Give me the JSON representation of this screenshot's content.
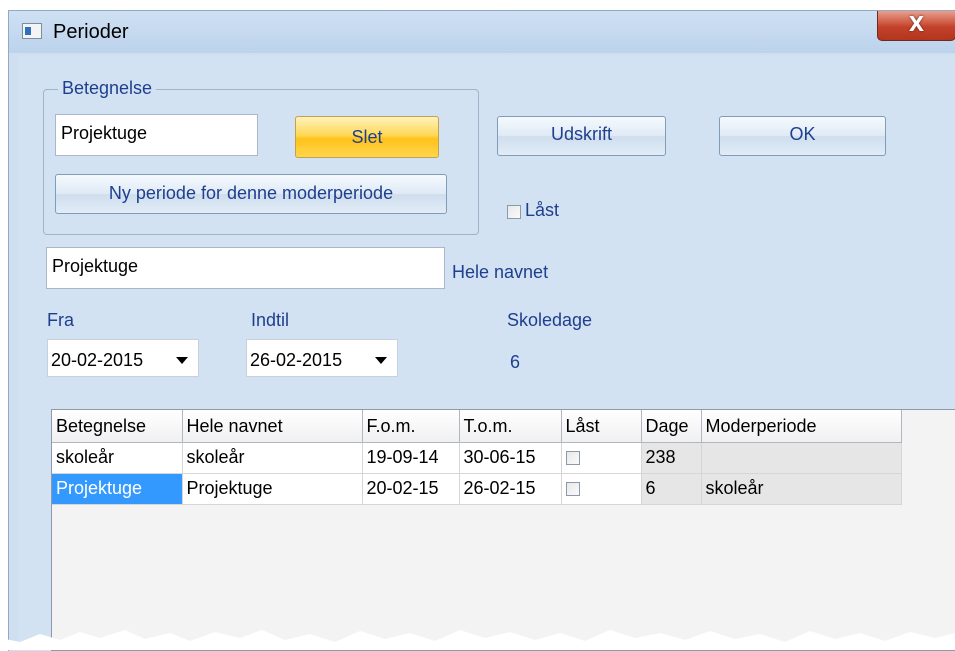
{
  "window": {
    "title": "Perioder",
    "close_label": "X"
  },
  "group": {
    "title": "Betegnelse",
    "short_name_value": "Projektuge",
    "delete_label": "Slet",
    "new_period_label": "Ny periode for denne moderperiode"
  },
  "buttons": {
    "print_label": "Udskrift",
    "ok_label": "OK"
  },
  "locked": {
    "label": "Låst",
    "checked": false
  },
  "full_name": {
    "value": "Projektuge",
    "label": "Hele navnet"
  },
  "from": {
    "label": "Fra",
    "value": "20-02-2015"
  },
  "until": {
    "label": "Indtil",
    "value": "26-02-2015"
  },
  "school_days": {
    "label": "Skoledage",
    "value": "6"
  },
  "table": {
    "headers": [
      "Betegnelse",
      "Hele navnet",
      "F.o.m.",
      "T.o.m.",
      "Låst",
      "Dage",
      "Moderperiode"
    ],
    "rows": [
      {
        "betegnelse": "skoleår",
        "hele_navnet": "skoleår",
        "fom": "19-09-14",
        "tom": "30-06-15",
        "laast": false,
        "dage": "238",
        "moderperiode": ""
      },
      {
        "betegnelse": "Projektuge",
        "hele_navnet": "Projektuge",
        "fom": "20-02-15",
        "tom": "26-02-15",
        "laast": false,
        "dage": "6",
        "moderperiode": "skoleår"
      }
    ]
  }
}
